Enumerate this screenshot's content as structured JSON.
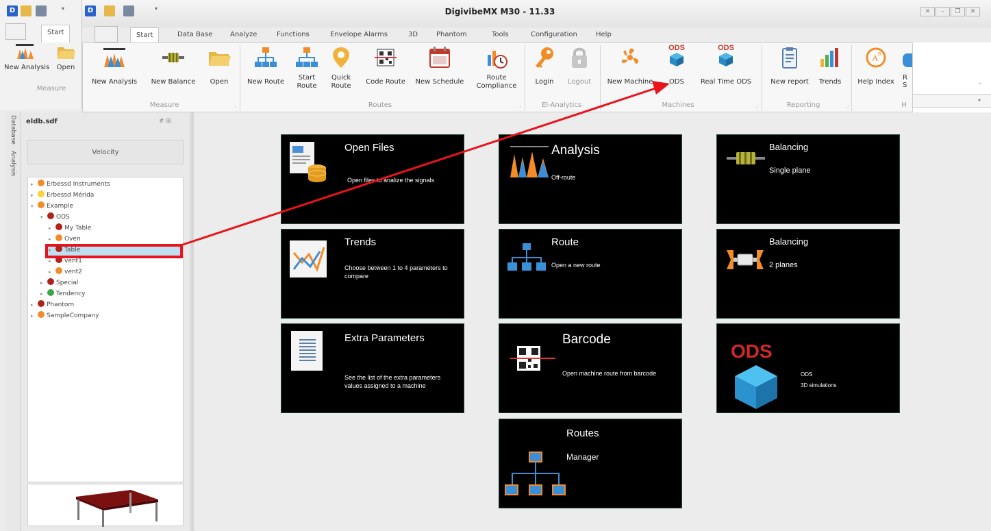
{
  "window": {
    "title": "DigivibeMX M30 - 11.33"
  },
  "back_window": {
    "tab_start": "Start",
    "buttons": {
      "new_analysis": "New Analysis",
      "open": "Open"
    },
    "group_measure": "Measure"
  },
  "tabs": [
    "Start",
    "Data Base",
    "Analyze",
    "Functions",
    "Envelope Alarms",
    "3D",
    "Phantom",
    "Tools",
    "Configuration",
    "Help"
  ],
  "ribbon": {
    "measure": {
      "label": "Measure",
      "new_analysis": "New Analysis",
      "new_balance": "New Balance",
      "open": "Open"
    },
    "routes": {
      "label": "Routes",
      "new_route": "New Route",
      "start_route_1": "Start",
      "start_route_2": "Route",
      "quick_route_1": "Quick",
      "quick_route_2": "Route",
      "code_route": "Code Route",
      "new_schedule": "New Schedule",
      "route_compliance_1": "Route",
      "route_compliance_2": "Compliance"
    },
    "el_analytics": {
      "label": "El-Analytics",
      "login": "Login",
      "logout": "Logout"
    },
    "machines": {
      "label": "Machines",
      "new_machine": "New Machine",
      "ods": "ODS",
      "real_time_ods": "Real Time ODS",
      "ods_badge": "ODS"
    },
    "reporting": {
      "label": "Reporting",
      "new_report": "New report",
      "trends": "Trends"
    },
    "help": {
      "label": "H",
      "help_index": "Help Index",
      "partial_1": "R",
      "partial_2": "S"
    }
  },
  "sidebar": {
    "vtabs": [
      "Database",
      "Analysis"
    ],
    "file": "eldb.sdf",
    "pin": "# ⊞",
    "velocity": "Velocity",
    "tree": [
      {
        "label": "Erbessd Instruments"
      },
      {
        "label": "Erbessd Mérida"
      },
      {
        "label": "Example"
      },
      {
        "label": "ODS"
      },
      {
        "label": "My Table"
      },
      {
        "label": "Oven"
      },
      {
        "label": "Table"
      },
      {
        "label": "vent1"
      },
      {
        "label": "vent2"
      },
      {
        "label": "Special"
      },
      {
        "label": "Tendency"
      },
      {
        "label": "Phantom"
      },
      {
        "label": "SampleCompany"
      }
    ]
  },
  "tiles": {
    "open_files": {
      "title": "Open Files",
      "desc": "Open files to analize the signals"
    },
    "analysis": {
      "title": "Analysis",
      "desc": "Off-route"
    },
    "balancing1": {
      "title": "Balancing",
      "desc": "Single plane"
    },
    "trends": {
      "title": "Trends",
      "desc1": "Choose between 1 to 4 parameters to",
      "desc2": "compare"
    },
    "route": {
      "title": "Route",
      "desc": "Open a new route"
    },
    "balancing2": {
      "title": "Balancing",
      "desc": "2 planes"
    },
    "extra_params": {
      "title": "Extra Parameters",
      "desc1": "See the list of the extra parameters",
      "desc2": "values assigned to a machine"
    },
    "barcode": {
      "title": "Barcode",
      "desc": "Open machine route from barcode"
    },
    "ods": {
      "title": "ODS",
      "desc1": "ODS",
      "desc2": "3D simulations"
    },
    "routes": {
      "title": "Routes",
      "desc": "Manager"
    }
  },
  "colors": {
    "annotation": "#e8131b",
    "tile_bg": "#000000",
    "tile_border": "#1e4d3a",
    "icon_orange": "#f28c28",
    "icon_blue": "#3a8fd8"
  }
}
